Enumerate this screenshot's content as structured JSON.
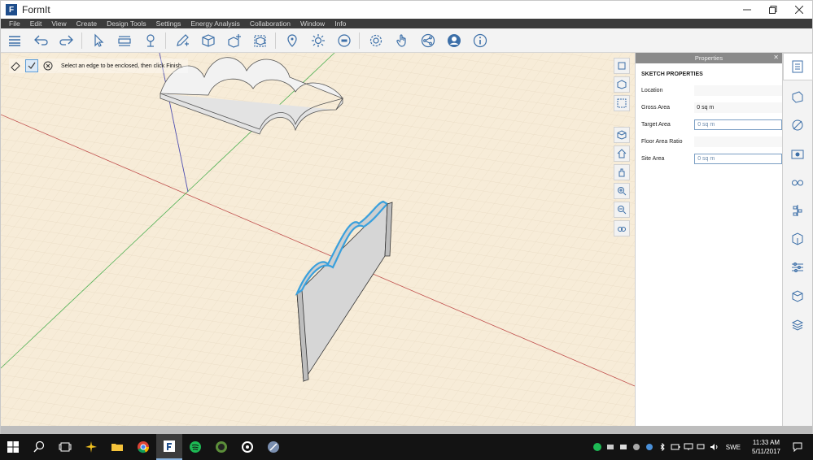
{
  "window": {
    "title": "FormIt",
    "logo_letter": "F",
    "controls": [
      "minimize-icon",
      "maximize-icon",
      "close-icon"
    ]
  },
  "menu": [
    "File",
    "Edit",
    "View",
    "Create",
    "Design Tools",
    "Settings",
    "Energy Analysis",
    "Collaboration",
    "Window",
    "Info"
  ],
  "hint": {
    "text": "Select an edge to be enclosed, then click Finish."
  },
  "properties": {
    "header": "Properties",
    "section_title": "SKETCH PROPERTIES",
    "rows": [
      {
        "label": "Location",
        "value": ""
      },
      {
        "label": "Gross Area",
        "value": "0 sq m"
      },
      {
        "label": "Target Area",
        "value": "0 sq m"
      },
      {
        "label": "Floor Area Ratio",
        "value": ""
      },
      {
        "label": "Site Area",
        "value": "0 sq m"
      }
    ]
  },
  "taskbar": {
    "language": "SWE",
    "time": "11:33 AM",
    "date": "5/11/2017"
  },
  "colors": {
    "menubar": "#3b3b3b",
    "viewport": "#f7ecd8",
    "accent": "#3aa0dc",
    "taskbar": "#131313"
  }
}
